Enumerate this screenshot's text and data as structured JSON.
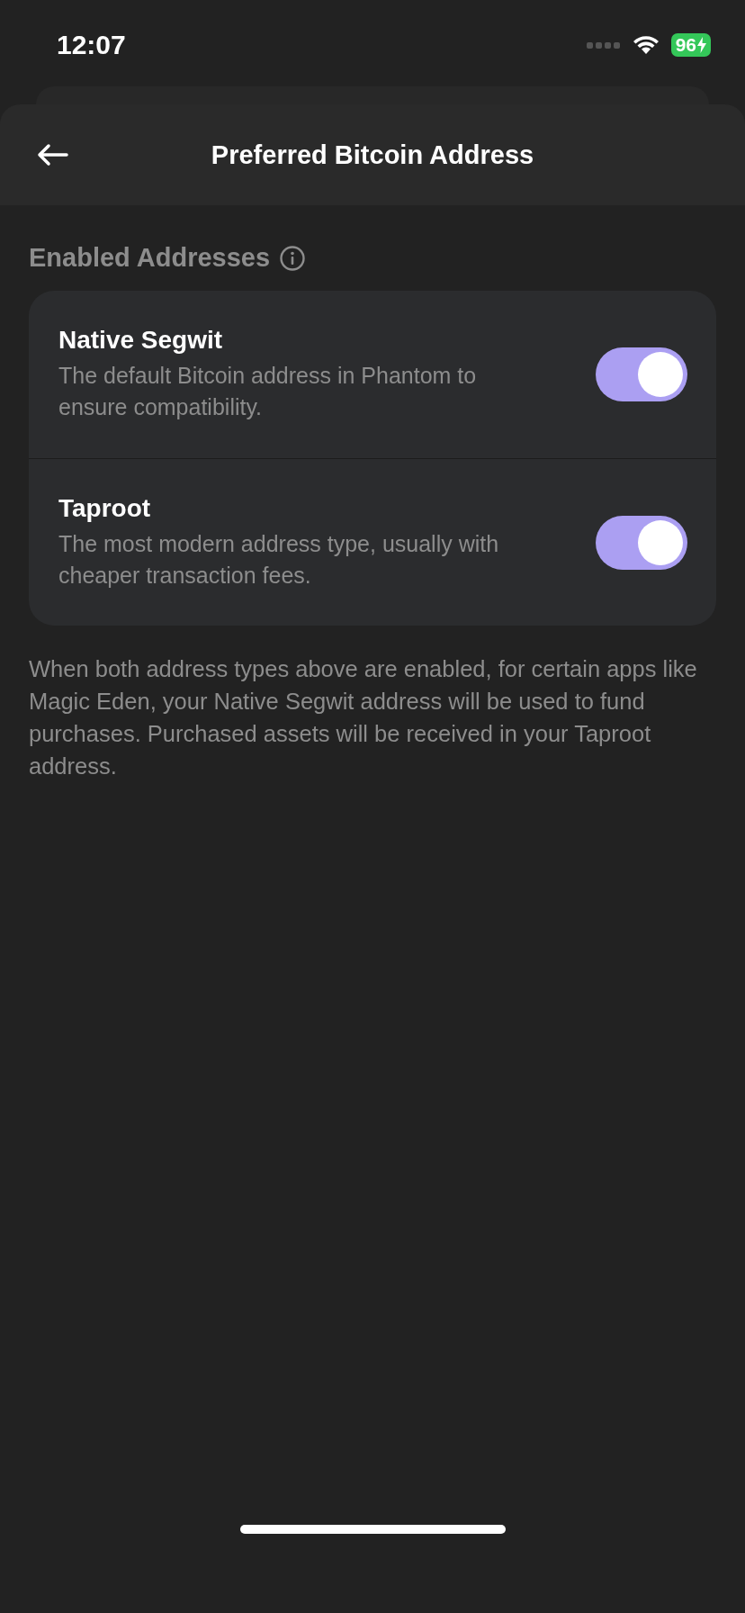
{
  "status_bar": {
    "time": "12:07",
    "battery": "96",
    "charging": true
  },
  "header": {
    "title": "Preferred Bitcoin Address"
  },
  "section": {
    "label": "Enabled Addresses"
  },
  "addresses": [
    {
      "name": "Native Segwit",
      "description": "The default Bitcoin address in Phantom to ensure compatibility.",
      "on": true
    },
    {
      "name": "Taproot",
      "description": "The most modern address type, usually with cheaper transaction fees.",
      "on": true
    }
  ],
  "note": "When both address types above are enabled, for certain apps like Magic Eden, your Native Segwit address will be used to fund purchases. Purchased assets will be received in your Taproot address."
}
